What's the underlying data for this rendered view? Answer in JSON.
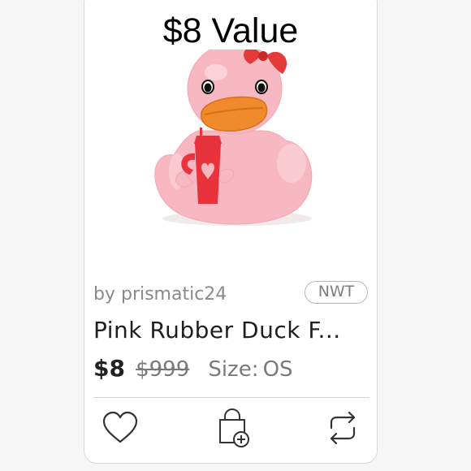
{
  "listing": {
    "overlay_text": "$8 Value",
    "seller": "by prismatic24",
    "condition_badge": "NWT",
    "title": "Pink Rubber Duck F...",
    "price": "$8",
    "original_price": "$999",
    "size_label": "Size:",
    "size_value": "OS"
  },
  "actions": {
    "like_icon": "heart-icon",
    "bundle_icon": "bag-plus-icon",
    "share_icon": "repeat-arrows-icon"
  },
  "colors": {
    "duck_body": "#f7b7c0",
    "duck_beak": "#f08a2a",
    "cup": "#e8323c",
    "bow": "#e53a3a"
  }
}
